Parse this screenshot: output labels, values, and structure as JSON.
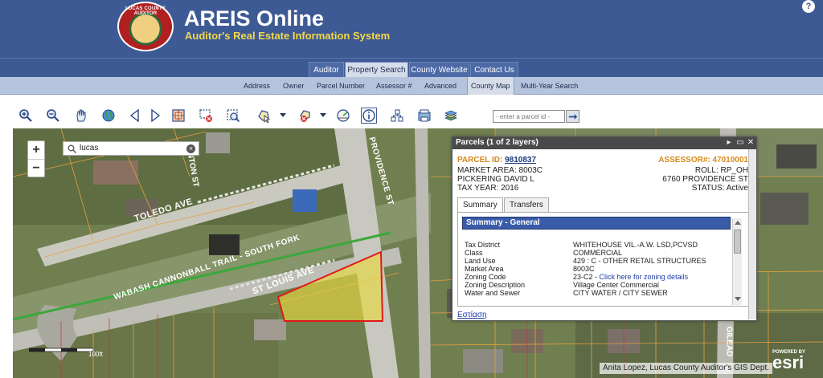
{
  "header": {
    "logo_text": "LUCAS COUNTY AUDITOR",
    "title": "AREIS Online",
    "subtitle": "Auditor's Real Estate Information System",
    "help_icon": "?"
  },
  "nav_primary": [
    {
      "label": "Auditor"
    },
    {
      "label": "Property Search"
    },
    {
      "label": "County Website"
    },
    {
      "label": "Contact Us"
    }
  ],
  "nav_secondary": [
    {
      "label": "Address"
    },
    {
      "label": "Owner"
    },
    {
      "label": "Parcel Number"
    },
    {
      "label": "Assessor #"
    },
    {
      "label": "Advanced"
    },
    {
      "label": "County Map"
    },
    {
      "label": "Multi-Year Search"
    }
  ],
  "active_tab": "County Map",
  "toolbar": {
    "tools": [
      "zoom-in-icon",
      "zoom-out-icon",
      "pan-hand-icon",
      "globe-icon",
      "previous-extent-icon",
      "next-extent-icon",
      "full-extent-icon",
      "select-rectangle-icon",
      "identify-icon",
      "select-shape-icon",
      "clear-selection-icon",
      "measure-icon",
      "info-icon",
      "buffer-icon",
      "print-icon",
      "layers-icon"
    ],
    "parcel_placeholder": "- enter a parcel id -"
  },
  "map": {
    "search_value": "lucas",
    "zoom_in": "+",
    "zoom_out": "−",
    "street_labels": [
      "TOLEDO AVE",
      "WABASH CANNONBALL TRAIL - SOUTH FORK",
      "ST LOUIS AVE",
      "PROVIDENCE ST",
      "GILEAD",
      "NTON ST"
    ],
    "attribution": "Anita Lopez, Lucas County Auditor's GIS Dept.",
    "esri_small": "POWERED BY",
    "esri_big": "esri",
    "scale_label": "100ft"
  },
  "popup": {
    "title": "Parcels (1 of 2 layers)",
    "controls": [
      "▸",
      "▭",
      "✕"
    ],
    "parcel_id_label": "PARCEL ID:",
    "parcel_id": "9810837",
    "assessor_label": "ASSESSOR#:",
    "assessor": "47010001",
    "market_area": "MARKET AREA: 8003C",
    "roll": "ROLL: RP_OH",
    "owner": "PICKERING DAVID L",
    "address": "6760 PROVIDENCE ST",
    "tax_year": "TAX YEAR: 2016",
    "status": "STATUS: Active",
    "tabs": [
      "Summary",
      "Transfers"
    ],
    "summary_header": "Summary - General",
    "rows": [
      {
        "key": "Tax District",
        "value": "WHITEHOUSE VIL.-A.W. LSD,PCVSD"
      },
      {
        "key": "Class",
        "value": "COMMERCIAL"
      },
      {
        "key": "Land Use",
        "value": "429 : C - OTHER RETAIL STRUCTURES"
      },
      {
        "key": "Market Area",
        "value": "8003C"
      },
      {
        "key": "Zoning Code",
        "value": "23-C2 - ",
        "link": "Click here for zoning details"
      },
      {
        "key": "Zoning Description",
        "value": "Village Center Commercial"
      },
      {
        "key": "Water and Sewer",
        "value": "CITY WATER / CITY SEWER"
      }
    ],
    "footer_link": "Εστίαση"
  }
}
